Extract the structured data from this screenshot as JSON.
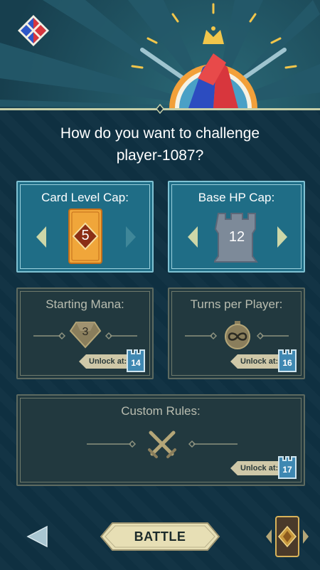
{
  "header": {
    "question_line1": "How do you want to challenge",
    "question_line2": "player-1087?"
  },
  "options": {
    "card_level_cap": {
      "label": "Card Level Cap:",
      "value": "5"
    },
    "base_hp_cap": {
      "label": "Base HP Cap:",
      "value": "12"
    },
    "starting_mana": {
      "label": "Starting Mana:",
      "value": "3",
      "unlock_text": "Unlock at:",
      "unlock_level": "14"
    },
    "turns_per_player": {
      "label": "Turns per Player:",
      "value_icon": "infinity-icon",
      "unlock_text": "Unlock at:",
      "unlock_level": "16"
    },
    "custom_rules": {
      "label": "Custom Rules:",
      "unlock_text": "Unlock at:",
      "unlock_level": "17"
    }
  },
  "footer": {
    "battle_label": "BATTLE"
  },
  "colors": {
    "background": "#0f3142",
    "active_panel": "#1f6d86",
    "locked_panel": "#22393f",
    "card_orange": "#f0a63a",
    "battle_button": "#e7dfb5"
  }
}
